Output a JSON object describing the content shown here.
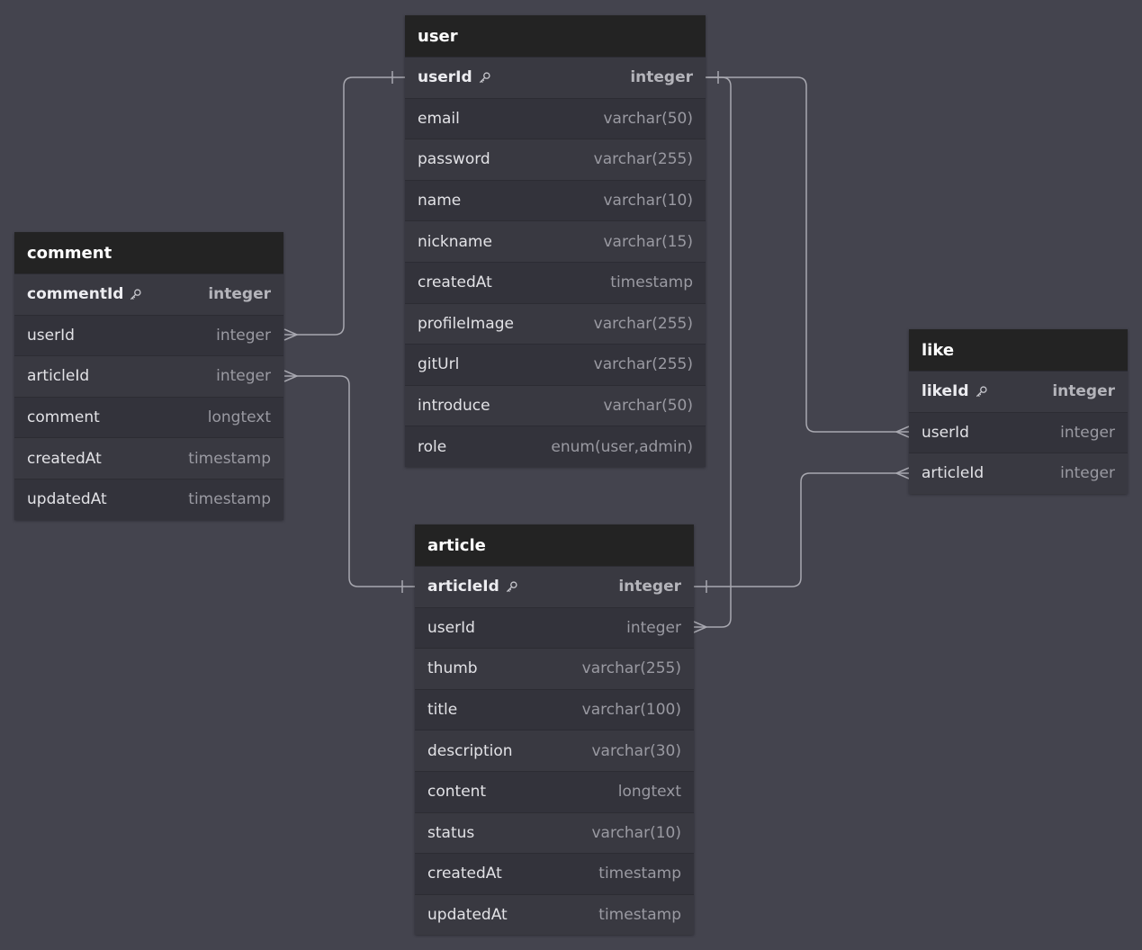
{
  "colors": {
    "background": "#44444e",
    "header": "#232323",
    "row": "#393941",
    "row_alt": "#33333b",
    "connector": "#a8a8b0"
  },
  "tables": {
    "user": {
      "title": "user",
      "columns": [
        {
          "name": "userId",
          "type": "integer",
          "pk": true
        },
        {
          "name": "email",
          "type": "varchar(50)"
        },
        {
          "name": "password",
          "type": "varchar(255)"
        },
        {
          "name": "name",
          "type": "varchar(10)"
        },
        {
          "name": "nickname",
          "type": "varchar(15)"
        },
        {
          "name": "createdAt",
          "type": "timestamp"
        },
        {
          "name": "profileImage",
          "type": "varchar(255)"
        },
        {
          "name": "gitUrl",
          "type": "varchar(255)"
        },
        {
          "name": "introduce",
          "type": "varchar(50)"
        },
        {
          "name": "role",
          "type": "enum(user,admin)"
        }
      ]
    },
    "comment": {
      "title": "comment",
      "columns": [
        {
          "name": "commentId",
          "type": "integer",
          "pk": true
        },
        {
          "name": "userId",
          "type": "integer"
        },
        {
          "name": "articleId",
          "type": "integer"
        },
        {
          "name": "comment",
          "type": "longtext"
        },
        {
          "name": "createdAt",
          "type": "timestamp"
        },
        {
          "name": "updatedAt",
          "type": "timestamp"
        }
      ]
    },
    "like": {
      "title": "like",
      "columns": [
        {
          "name": "likeId",
          "type": "integer",
          "pk": true
        },
        {
          "name": "userId",
          "type": "integer"
        },
        {
          "name": "articleId",
          "type": "integer"
        }
      ]
    },
    "article": {
      "title": "article",
      "columns": [
        {
          "name": "articleId",
          "type": "integer",
          "pk": true
        },
        {
          "name": "userId",
          "type": "integer"
        },
        {
          "name": "thumb",
          "type": "varchar(255)"
        },
        {
          "name": "title",
          "type": "varchar(100)"
        },
        {
          "name": "description",
          "type": "varchar(30)"
        },
        {
          "name": "content",
          "type": "longtext"
        },
        {
          "name": "status",
          "type": "varchar(10)"
        },
        {
          "name": "createdAt",
          "type": "timestamp"
        },
        {
          "name": "updatedAt",
          "type": "timestamp"
        }
      ]
    }
  },
  "relations": [
    {
      "from": "user.userId",
      "to": "comment.userId",
      "cardinality": "one-to-many"
    },
    {
      "from": "user.userId",
      "to": "like.userId",
      "cardinality": "one-to-many"
    },
    {
      "from": "user.userId",
      "to": "article.userId",
      "cardinality": "one-to-many"
    },
    {
      "from": "article.articleId",
      "to": "comment.articleId",
      "cardinality": "one-to-many"
    },
    {
      "from": "article.articleId",
      "to": "like.articleId",
      "cardinality": "one-to-many"
    }
  ]
}
